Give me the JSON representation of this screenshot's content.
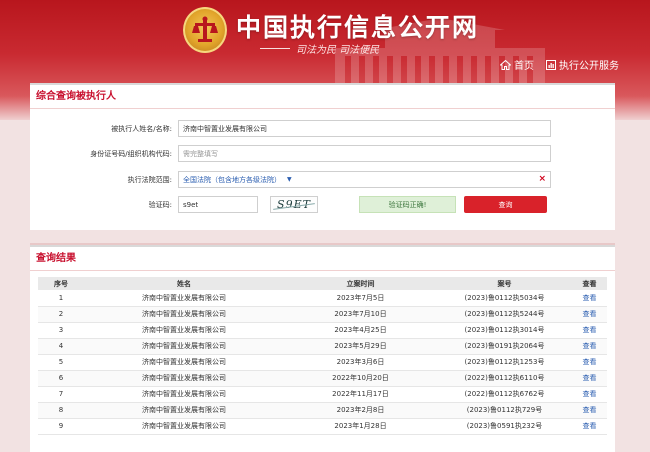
{
  "header": {
    "site_title": "中国执行信息公开网",
    "slogan": "司法为民 司法便民",
    "nav": [
      {
        "label": "首页",
        "icon": "home-icon"
      },
      {
        "label": "执行公开服务",
        "icon": "chart-icon"
      }
    ]
  },
  "query": {
    "section_title": "综合查询被执行人",
    "name_label": "被执行人姓名/名称:",
    "name_value": "济南中智置业发展有限公司",
    "id_label": "身份证号码/组织机构代码:",
    "id_placeholder": "需完整填写",
    "court_label": "执行法院范围:",
    "court_value": "全国法院（包含地方各级法院）",
    "captcha_label": "验证码:",
    "captcha_input": "s9et",
    "captcha_image_text": "S9ET",
    "captcha_status": "验证码正确!",
    "search_button": "查询"
  },
  "results": {
    "section_title": "查询结果",
    "columns": [
      "序号",
      "姓名",
      "立案时间",
      "案号",
      "查看"
    ],
    "rows": [
      {
        "seq": "1",
        "name": "济南中智置业发展有限公司",
        "date": "2023年7月5日",
        "case": "(2023)鲁0112执5034号",
        "view": "查看"
      },
      {
        "seq": "2",
        "name": "济南中智置业发展有限公司",
        "date": "2023年7月10日",
        "case": "(2023)鲁0112执5244号",
        "view": "查看"
      },
      {
        "seq": "3",
        "name": "济南中智置业发展有限公司",
        "date": "2023年4月25日",
        "case": "(2023)鲁0112执3014号",
        "view": "查看"
      },
      {
        "seq": "4",
        "name": "济南中智置业发展有限公司",
        "date": "2023年5月29日",
        "case": "(2023)鲁0191执2064号",
        "view": "查看"
      },
      {
        "seq": "5",
        "name": "济南中智置业发展有限公司",
        "date": "2023年3月6日",
        "case": "(2023)鲁0112执1253号",
        "view": "查看"
      },
      {
        "seq": "6",
        "name": "济南中智置业发展有限公司",
        "date": "2022年10月20日",
        "case": "(2022)鲁0112执6110号",
        "view": "查看"
      },
      {
        "seq": "7",
        "name": "济南中智置业发展有限公司",
        "date": "2022年11月17日",
        "case": "(2022)鲁0112执6762号",
        "view": "查看"
      },
      {
        "seq": "8",
        "name": "济南中智置业发展有限公司",
        "date": "2023年2月8日",
        "case": "(2023)鲁0112执729号",
        "view": "查看"
      },
      {
        "seq": "9",
        "name": "济南中智置业发展有限公司",
        "date": "2023年1月28日",
        "case": "(2023)鲁0591执232号",
        "view": "查看"
      }
    ]
  },
  "colors": {
    "brand_red": "#c8102e",
    "button_red": "#d9222a",
    "link_blue": "#2a5db0",
    "success_green": "#3c763d"
  }
}
